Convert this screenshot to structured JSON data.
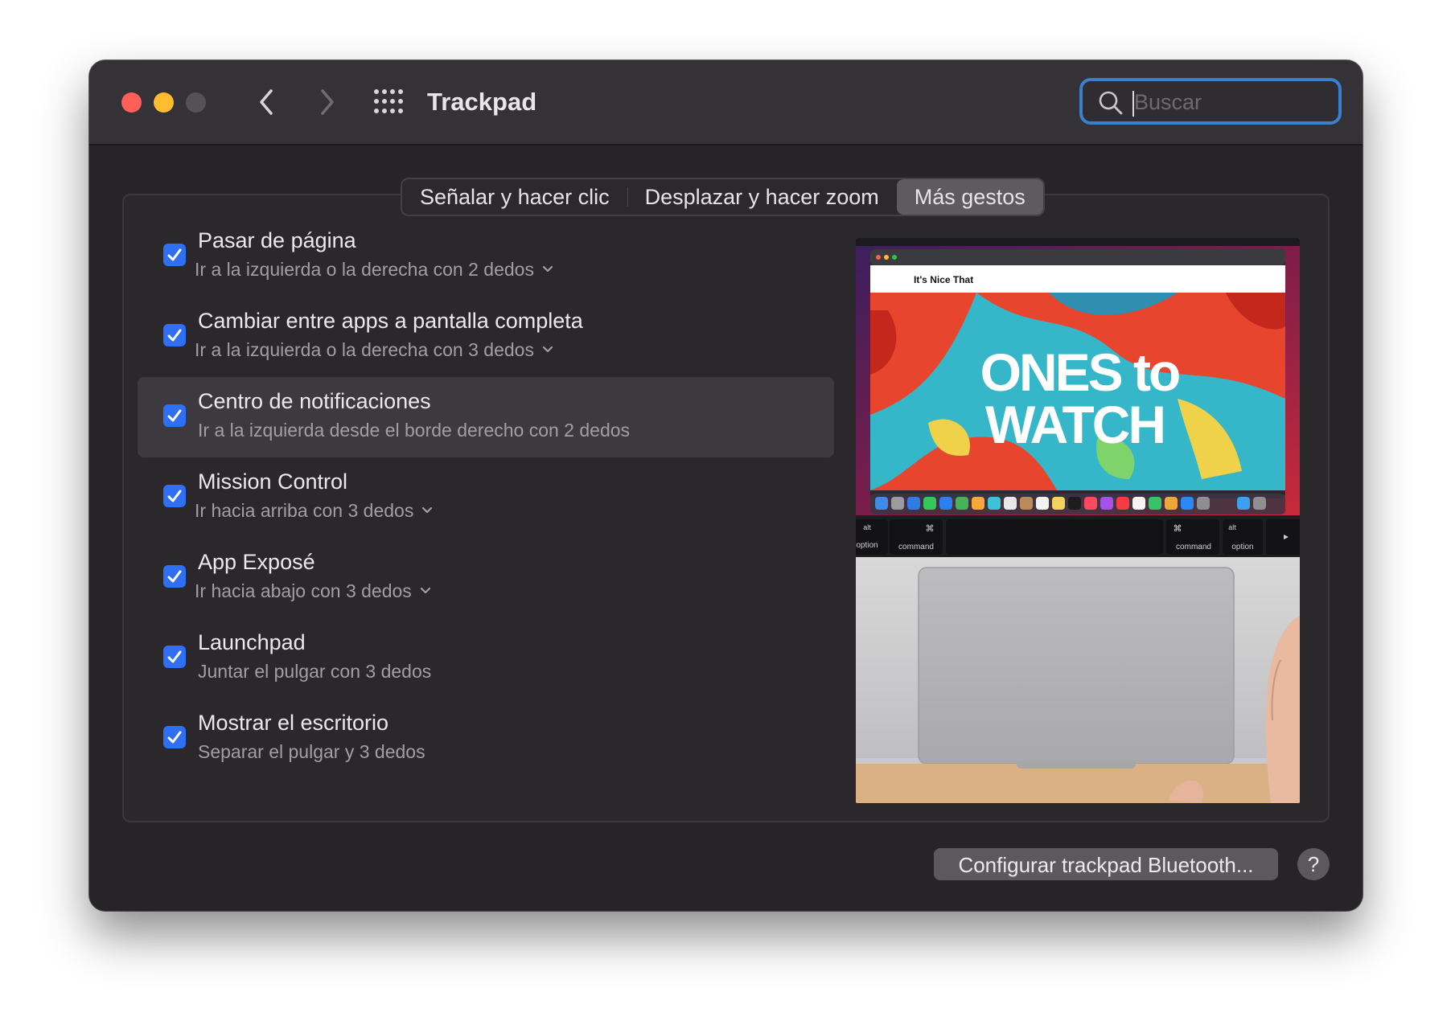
{
  "window": {
    "title": "Trackpad",
    "traffic_lights": {
      "close": "#fe5f57",
      "minimize": "#febc2e",
      "zoom": "#545256"
    }
  },
  "toolbar": {
    "back_icon": "chevron-left-icon",
    "forward_icon": "chevron-right-icon",
    "grid_icon": "show-all-grid-icon",
    "search": {
      "placeholder": "Buscar",
      "value": "",
      "icon": "search-icon"
    }
  },
  "tabs": [
    {
      "label": "Señalar y hacer clic",
      "active": false
    },
    {
      "label": "Desplazar y hacer zoom",
      "active": false
    },
    {
      "label": "Más gestos",
      "active": true
    }
  ],
  "gestures": [
    {
      "title": "Pasar de página",
      "subtitle": "Ir a la izquierda o la derecha con 2 dedos",
      "checked": true,
      "has_menu": true
    },
    {
      "title": "Cambiar entre apps a pantalla completa",
      "subtitle": "Ir a la izquierda o la derecha con 3 dedos",
      "checked": true,
      "has_menu": true
    },
    {
      "title": "Centro de notificaciones",
      "subtitle": "Ir a la izquierda desde el borde derecho con 2 dedos",
      "checked": true,
      "has_menu": false,
      "selected": true
    },
    {
      "title": "Mission Control",
      "subtitle": "Ir hacia arriba con 3 dedos",
      "checked": true,
      "has_menu": true
    },
    {
      "title": "App Exposé",
      "subtitle": "Ir hacia abajo con 3 dedos",
      "checked": true,
      "has_menu": true
    },
    {
      "title": "Launchpad",
      "subtitle": "Juntar el pulgar con 3 dedos",
      "checked": true,
      "has_menu": false
    },
    {
      "title": "Mostrar el escritorio",
      "subtitle": "Separar el pulgar y 3 dedos",
      "checked": true,
      "has_menu": false
    }
  ],
  "preview": {
    "site_name": "It's Nice That",
    "headline_line1": "ONES to",
    "headline_line2": "WATCH",
    "keys": {
      "left_alt": "alt",
      "left_option": "option",
      "left_cmd_symbol": "⌘",
      "left_command": "command",
      "right_cmd_symbol": "⌘",
      "right_command": "command",
      "right_alt": "alt",
      "right_option": "option"
    }
  },
  "footer": {
    "bluetooth_button": "Configurar trackpad Bluetooth...",
    "help_button": "?"
  },
  "colors": {
    "accent": "#2e6ff4",
    "focus_ring": "#3b7fce",
    "window_bg": "#262427"
  }
}
